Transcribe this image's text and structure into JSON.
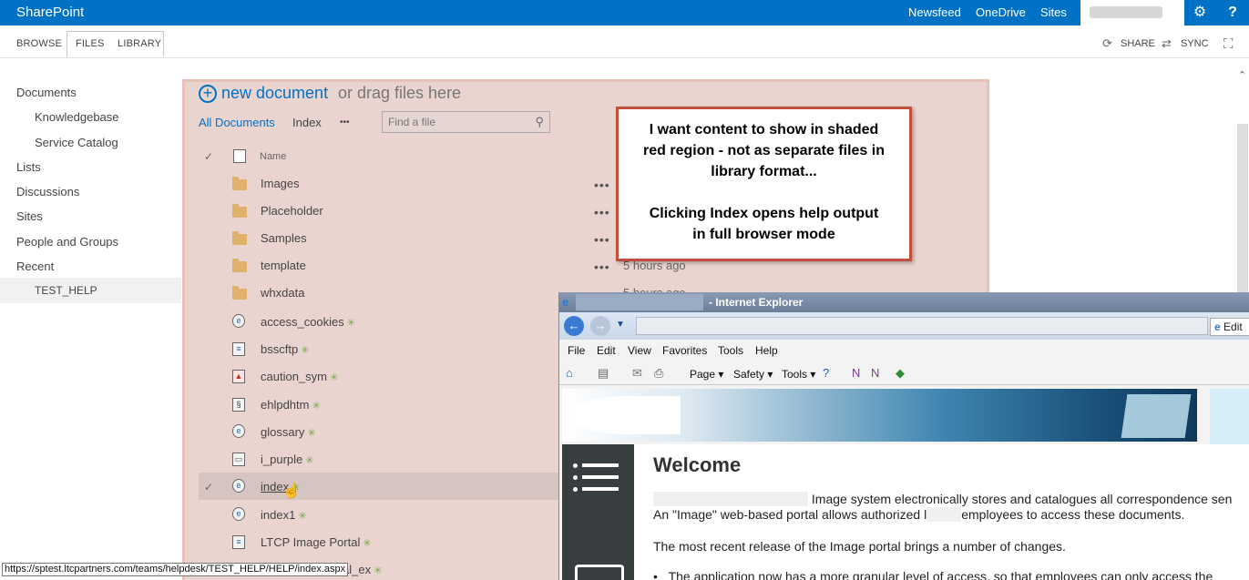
{
  "suite": {
    "brand": "SharePoint",
    "links": [
      "Newsfeed",
      "OneDrive",
      "Sites"
    ],
    "settings_icon": "gear-icon",
    "help_icon": "?"
  },
  "ribbon": {
    "tabs": [
      "BROWSE",
      "FILES",
      "LIBRARY"
    ],
    "share": "SHARE",
    "sync": "SYNC"
  },
  "leftnav": {
    "items": [
      "Documents",
      "Knowledgebase",
      "Service Catalog",
      "Lists",
      "Discussions",
      "Sites",
      "People and Groups",
      "Recent",
      "TEST_HELP"
    ]
  },
  "library": {
    "new_document": "new document",
    "drag_text": "or drag files here",
    "views": [
      "All Documents",
      "Index"
    ],
    "more": "•••",
    "search_placeholder": "Find a file",
    "column_name": "Name",
    "folders": [
      "Images",
      "Placeholder",
      "Samples",
      "template",
      "whxdata"
    ],
    "files": [
      "access_cookies",
      "bsscftp",
      "caution_sym",
      "ehlpdhtm",
      "glossary",
      "i_purple",
      "index",
      "index1",
      "LTCP Image Portal"
    ],
    "last_partial": "al_ex",
    "modified": [
      "5 hours ago",
      "5 hours ago"
    ],
    "new_marker": "✳"
  },
  "callout": {
    "line1": "I want content to show in shaded",
    "line2": "red region - not as separate files in",
    "line3": "library format...",
    "line4": "Clicking Index opens help output",
    "line5": "in full browser mode"
  },
  "ie": {
    "title": "- Internet Explorer",
    "edit": "Edit r",
    "menu": [
      "File",
      "Edit",
      "View",
      "Favorites",
      "Tools",
      "Help"
    ],
    "commands": [
      "Page",
      "Safety",
      "Tools"
    ],
    "welcome": "Welcome",
    "para1": "Image system electronically stores and catalogues all correspondence sen",
    "para2a": "An \"Image\" web-based portal allows authorized l",
    "para2b": "employees to access these documents.",
    "para3": "The most recent release of the Image portal brings a number of changes.",
    "para4": "The application now has a more granular level of access, so that employees can only access the"
  },
  "status": {
    "url": "https://sptest.ltcpartners.com/teams/helpdesk/TEST_HELP/HELP/index.aspx"
  }
}
